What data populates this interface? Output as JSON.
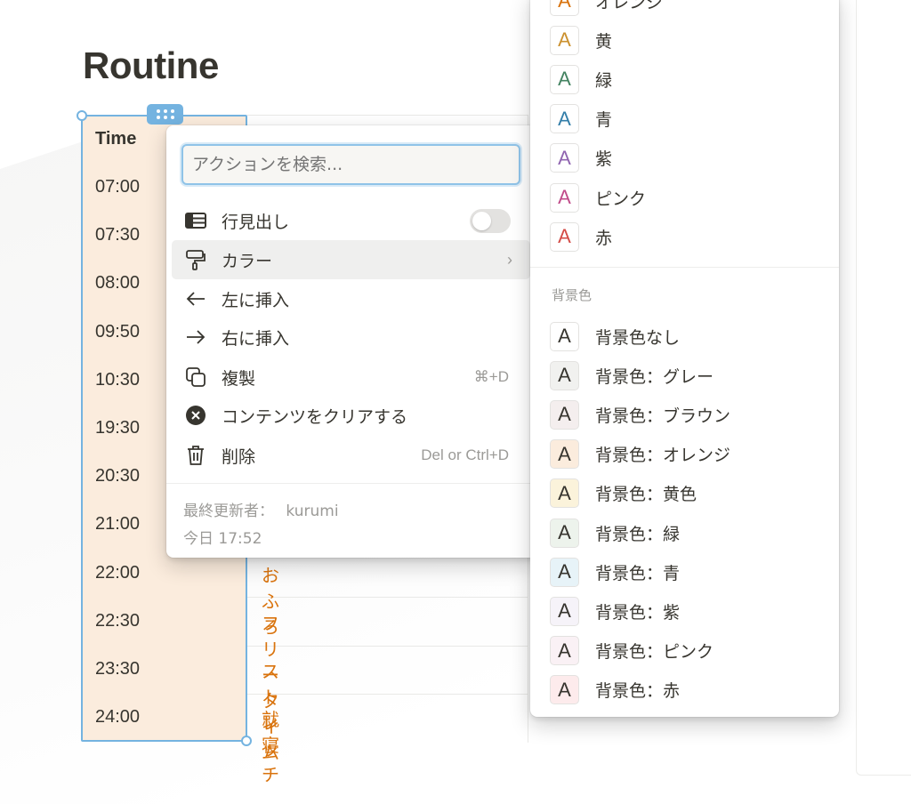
{
  "page": {
    "title": "Routine"
  },
  "table": {
    "header": "Time",
    "times": [
      "07:00",
      "07:30",
      "08:00",
      "09:50",
      "10:30",
      "19:30",
      "20:30",
      "21:00",
      "22:00",
      "22:30",
      "23:30",
      "24:00"
    ],
    "tasks_visible": [
      "おふろ",
      "フリータイム",
      "ストレッチ",
      "就寝"
    ],
    "time_column_bg": "#fbecdd",
    "selection_color": "#74b3e0",
    "task_text_color": "#d9730d"
  },
  "menu": {
    "search_placeholder": "アクションを検索...",
    "items": [
      {
        "label": "行見出し",
        "icon": "table-header-icon",
        "toggle": false
      },
      {
        "label": "カラー",
        "icon": "paint-roller-icon",
        "has_submenu": true
      },
      {
        "label": "左に挿入",
        "icon": "arrow-left-icon"
      },
      {
        "label": "右に挿入",
        "icon": "arrow-right-icon"
      },
      {
        "label": "複製",
        "icon": "duplicate-icon",
        "shortcut": "⌘+D"
      },
      {
        "label": "コンテンツをクリアする",
        "icon": "clear-circle-icon"
      },
      {
        "label": "削除",
        "icon": "trash-icon",
        "shortcut": "Del or Ctrl+D"
      }
    ],
    "footer": {
      "edited_by_label": "最終更新者：",
      "edited_by": "kurumi",
      "edited_at": "今日 17:52"
    }
  },
  "color_submenu": {
    "text_colors": [
      {
        "label": "オレンジ",
        "color": "#d9730d"
      },
      {
        "label": "黄",
        "color": "#cb912f"
      },
      {
        "label": "緑",
        "color": "#448361"
      },
      {
        "label": "青",
        "color": "#337ea9"
      },
      {
        "label": "紫",
        "color": "#9065b0"
      },
      {
        "label": "ピンク",
        "color": "#c14c8a"
      },
      {
        "label": "赤",
        "color": "#d44c47"
      }
    ],
    "bg_heading": "背景色",
    "background_colors": [
      {
        "label": "背景色なし",
        "bg": "#ffffff"
      },
      {
        "label": "背景色：グレー",
        "bg": "#f1f1ef"
      },
      {
        "label": "背景色：ブラウン",
        "bg": "#f4eeee"
      },
      {
        "label": "背景色：オレンジ",
        "bg": "#fbecdd"
      },
      {
        "label": "背景色：黄色",
        "bg": "#fbf3db"
      },
      {
        "label": "背景色：緑",
        "bg": "#edf3ec"
      },
      {
        "label": "背景色：青",
        "bg": "#e7f3f8"
      },
      {
        "label": "背景色：紫",
        "bg": "#f6f3f9"
      },
      {
        "label": "背景色：ピンク",
        "bg": "#faf1f5"
      },
      {
        "label": "背景色：赤",
        "bg": "#fdebec"
      }
    ],
    "swatch_glyph": "A"
  }
}
